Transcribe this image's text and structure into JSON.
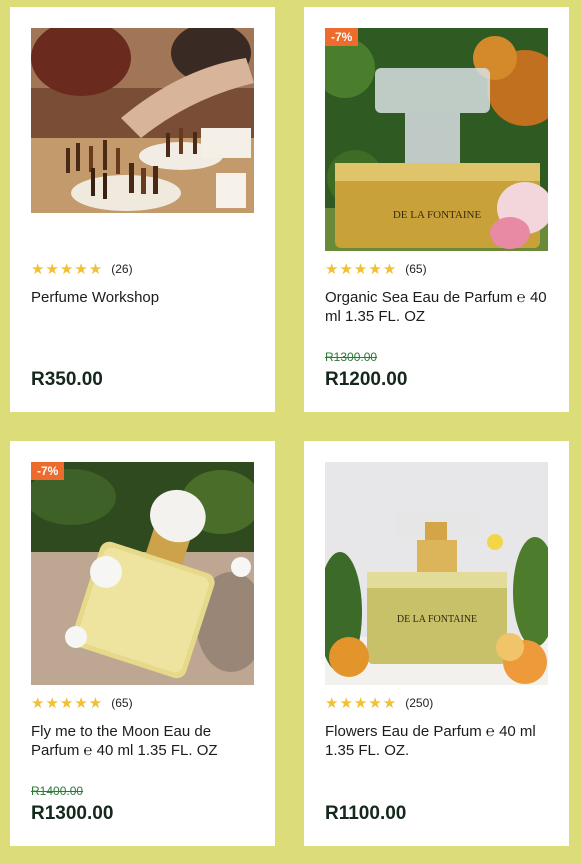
{
  "products": [
    {
      "badge": "",
      "stars": "★★★★★",
      "review_count": "(26)",
      "title": "Perfume Workshop",
      "old_price": "",
      "price": "R350.00",
      "image_icon": "perfume-workshop-photo"
    },
    {
      "badge": "-7%",
      "stars": "★★★★★",
      "review_count": "(65)",
      "title": "Organic Sea Eau de Parfum ℮ 40 ml 1.35 FL. OZ",
      "old_price": "R1300.00",
      "price": "R1200.00",
      "image_icon": "perfume-bottle-photo",
      "label_text": "DE LA FONTAINE"
    },
    {
      "badge": "-7%",
      "stars": "★★★★★",
      "review_count": "(65)",
      "title": "Fly me to the Moon Eau de Parfum ℮ 40 ml 1.35 FL. OZ",
      "old_price": "R1400.00",
      "price": "R1300.00",
      "image_icon": "perfume-bottle-photo"
    },
    {
      "badge": "",
      "stars": "★★★★★",
      "review_count": "(250)",
      "title": "Flowers Eau de Parfum ℮ 40 ml 1.35 FL. OZ.",
      "old_price": "",
      "price": "R1100.00",
      "image_icon": "perfume-bottle-photo",
      "label_text": "DE LA FONTAINE"
    }
  ],
  "colors": {
    "background": "#dcdc78",
    "star": "#f2c033",
    "badge": "#ec6b2d",
    "old_price": "#2c7a35",
    "price": "#14281c"
  }
}
